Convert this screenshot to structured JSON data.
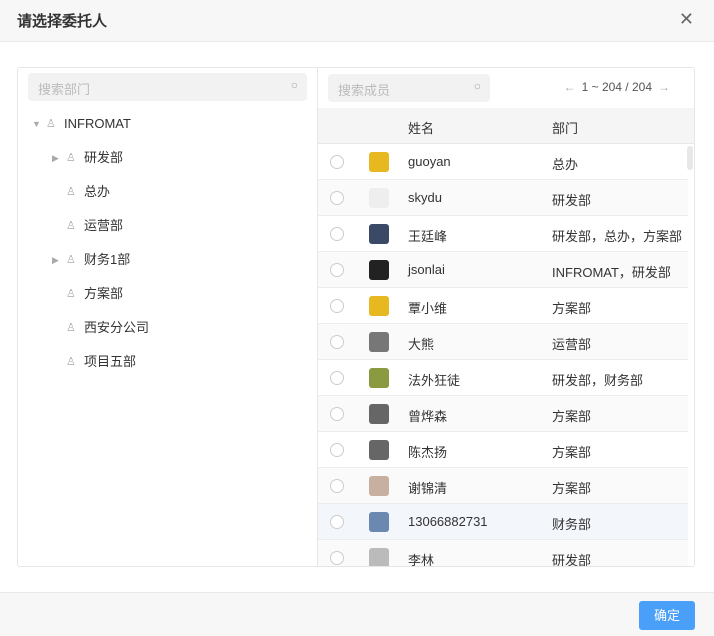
{
  "dialog": {
    "title": "请选择委托人",
    "confirm_label": "确定"
  },
  "dept_search": {
    "placeholder": "搜索部门"
  },
  "member_search": {
    "placeholder": "搜索成员"
  },
  "pagination": {
    "text": "1 ~ 204 / 204"
  },
  "tree": [
    {
      "label": "INFROMAT",
      "level": 0,
      "expanded": true,
      "expandable": true
    },
    {
      "label": "研发部",
      "level": 1,
      "expandable": true
    },
    {
      "label": "总办",
      "level": 1,
      "expandable": false
    },
    {
      "label": "运营部",
      "level": 1,
      "expandable": false
    },
    {
      "label": "财务1部",
      "level": 1,
      "expandable": true
    },
    {
      "label": "方案部",
      "level": 1,
      "expandable": false
    },
    {
      "label": "西安分公司",
      "level": 1,
      "expandable": false
    },
    {
      "label": "项目五部",
      "level": 1,
      "expandable": false
    }
  ],
  "table": {
    "columns": [
      "姓名",
      "部门"
    ],
    "rows": [
      {
        "name": "guoyan",
        "dept": "总办",
        "avatar": "#e8b820"
      },
      {
        "name": "skydu",
        "dept": "研发部",
        "avatar": "#eeeeee"
      },
      {
        "name": "王廷峰",
        "dept": "研发部，总办，方案部",
        "avatar": "#3a4a66"
      },
      {
        "name": "jsonlai",
        "dept": "INFROMAT，研发部",
        "avatar": "#222222"
      },
      {
        "name": "覃小维",
        "dept": "方案部",
        "avatar": "#e8b820"
      },
      {
        "name": "大熊",
        "dept": "运营部",
        "avatar": "#777777"
      },
      {
        "name": "法外狂徒",
        "dept": "研发部，财务部",
        "avatar": "#8a9a40"
      },
      {
        "name": "曾烨森",
        "dept": "方案部",
        "avatar": "#666666"
      },
      {
        "name": "陈杰扬",
        "dept": "方案部",
        "avatar": "#666666"
      },
      {
        "name": "谢锦清",
        "dept": "方案部",
        "avatar": "#c8b0a0"
      },
      {
        "name": "13066882731",
        "dept": "财务部",
        "avatar": "#6a88b0"
      },
      {
        "name": "李林",
        "dept": "研发部",
        "avatar": "#bbbbbb"
      }
    ]
  }
}
